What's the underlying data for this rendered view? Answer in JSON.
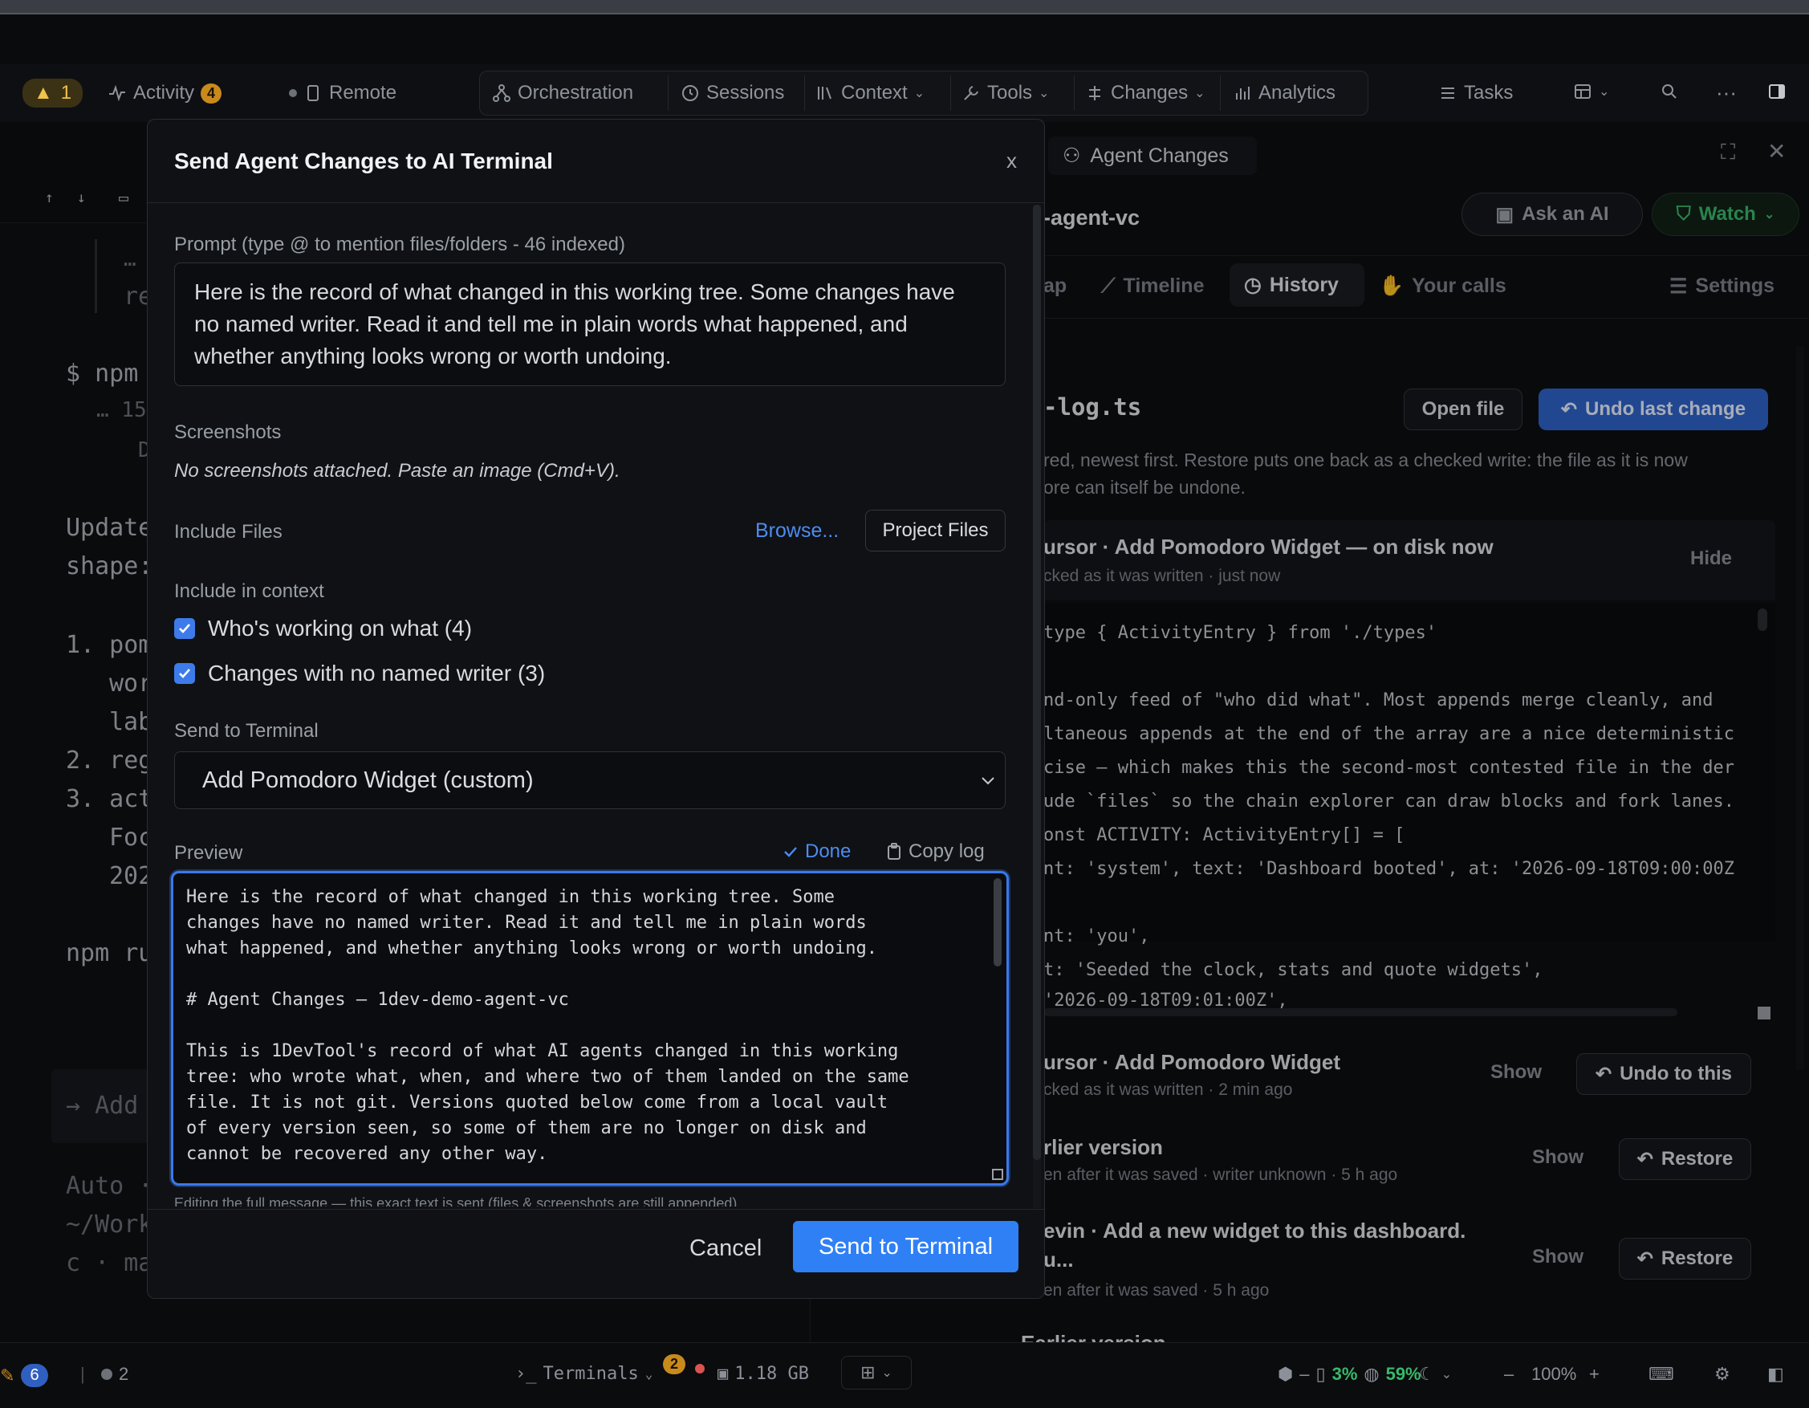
{
  "toolbar": {
    "warning_count": "1",
    "activity_label": "Activity",
    "activity_count": "4",
    "remote_label": "Remote",
    "orchestration_label": "Orchestration",
    "sessions_label": "Sessions",
    "context_label": "Context",
    "tools_label": "Tools",
    "changes_label": "Changes",
    "analytics_label": "Analytics",
    "tasks_label": "Tasks"
  },
  "left_pane": {
    "lines": [
      "…",
      "re",
      "$ npm",
      "… 15",
      "D",
      "Update",
      "shape:",
      "1. pom",
      "wor",
      "lab",
      "2. reg",
      "3. act",
      "Foc",
      "202",
      "npm ru",
      "→ Add",
      "Auto ·",
      "~/Work",
      "c · ma"
    ]
  },
  "right_pane": {
    "tab_title": "Agent Changes",
    "repo_name": "-agent-vc",
    "ask_ai_label": "Ask an AI",
    "watch_label": "Watch",
    "tabs": {
      "map": "ap",
      "timeline": "Timeline",
      "history": "History",
      "your_calls": "Your calls",
      "settings": "Settings"
    },
    "file_name": "-log.ts",
    "open_file_label": "Open file",
    "undo_last_label": "Undo last change",
    "desc_line1": "red, newest first. Restore puts one back as a checked write: the file as it is now",
    "desc_line2": "ore can itself be undone.",
    "current": {
      "title": "ursor · Add Pomodoro Widget — on disk now",
      "subtitle": "cked as it was written · just now",
      "hide_label": "Hide"
    },
    "code_lines": [
      "type { ActivityEntry } from './types'",
      "",
      "nd-only feed of \"who did what\". Most appends merge cleanly, and",
      "ltaneous appends at the end of the array are a nice deterministic",
      "cise — which makes this the second-most contested file in the der",
      "ude `files` so the chain explorer can draw blocks and fork lanes.",
      "onst ACTIVITY: ActivityEntry[] = [",
      "nt: 'system', text: 'Dashboard booted', at: '2026-09-18T09:00:00Z",
      "",
      "nt: 'you',",
      "t: 'Seeded the clock, stats and quote widgets',",
      " '2026-09-18T09:01:00Z',"
    ],
    "history": [
      {
        "title": "ursor · Add Pomodoro Widget",
        "subtitle": "cked as it was written · 2 min ago",
        "show_label": "Show",
        "action_label": "Undo to this"
      },
      {
        "title": "rlier version",
        "subtitle": "en after it was saved · writer unknown · 5 h ago",
        "show_label": "Show",
        "action_label": "Restore"
      },
      {
        "title": "evin · Add a new widget to this dashboard.",
        "title2": "u...",
        "subtitle": "en after it was saved · 5 h ago",
        "show_label": "Show",
        "action_label": "Restore"
      },
      {
        "title": "Earlier version"
      }
    ]
  },
  "status_bar": {
    "notif_count": "6",
    "dot_count": "2",
    "terminals_label": "Terminals",
    "terminals_count": "2",
    "memory": "1.18 GB",
    "cpu_pct": "3%",
    "battery_pct": "59%",
    "zoom": "100%"
  },
  "modal": {
    "title": "Send Agent Changes to AI Terminal",
    "close_label": "x",
    "prompt_label": "Prompt (type @ to mention files/folders - 46 indexed)",
    "prompt_value": "Here is the record of what changed in this working tree. Some changes have no named writer. Read it and tell me in plain words what happened, and whether anything looks wrong or worth undoing.",
    "screenshots_label": "Screenshots",
    "screenshots_hint": "No screenshots attached. Paste an image (Cmd+V).",
    "include_files_label": "Include Files",
    "browse_label": "Browse...",
    "project_files_label": "Project Files",
    "include_context_label": "Include in context",
    "context_options": [
      {
        "label": "Who's working on what (4)",
        "checked": true
      },
      {
        "label": "Changes with no named writer (3)",
        "checked": true
      }
    ],
    "send_to_terminal_label": "Send to Terminal",
    "terminal_selected": "Add Pomodoro Widget (custom)",
    "preview_label": "Preview",
    "done_label": "Done",
    "copy_log_label": "Copy log",
    "preview_text": "Here is the record of what changed in this working tree. Some\nchanges have no named writer. Read it and tell me in plain words\nwhat happened, and whether anything looks wrong or worth undoing.\n\n# Agent Changes — 1dev-demo-agent-vc\n\nThis is 1DevTool's record of what AI agents changed in this working\ntree: who wrote what, when, and where two of them landed on the same\nfile. It is not git. Versions quoted below come from a local vault\nof every version seen, so some of them are no longer on disk and\ncannot be recovered any other way.",
    "editing_note": "Editing the full message — this exact text is sent (files & screenshots are still appended)",
    "cancel_label": "Cancel",
    "send_label": "Send to Terminal"
  },
  "colors": {
    "accent": "#2f80f5",
    "warning": "#f0c14b",
    "badge_orange": "#c98a1c",
    "watch_green": "#39b86a"
  }
}
